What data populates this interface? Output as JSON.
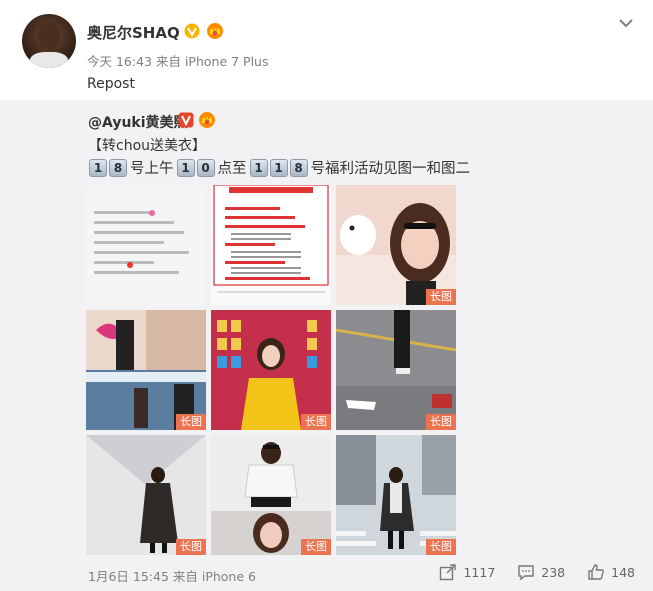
{
  "header": {
    "username": "奥尼尔SHAQ",
    "meta": "今天 16:43 来自 iPhone 7 Plus",
    "repost_text": "Repost"
  },
  "original": {
    "username": "@Ayuki黄美熙",
    "line1": "【转chou送美衣】",
    "line2": {
      "k1": "1",
      "k2": "8",
      "t1": "号上午",
      "k3": "1",
      "k4": "0",
      "t2": "点至",
      "k5": "1",
      "k6": "1",
      "k7": "8",
      "t3": "号福利活动见图一和图二"
    },
    "images": [
      {
        "name": "image-1",
        "badge": ""
      },
      {
        "name": "image-2",
        "badge": ""
      },
      {
        "name": "image-3",
        "badge": "长图"
      },
      {
        "name": "image-4",
        "badge": "长图"
      },
      {
        "name": "image-5",
        "badge": "长图"
      },
      {
        "name": "image-6",
        "badge": "长图"
      },
      {
        "name": "image-7",
        "badge": "长图"
      },
      {
        "name": "image-8",
        "badge": "长图"
      },
      {
        "name": "image-9",
        "badge": "长图"
      }
    ],
    "footer_meta": "1月6日 15:45 来自 iPhone 6",
    "actions": {
      "reposts": "1117",
      "comments": "238",
      "likes": "148"
    }
  },
  "colors": {
    "badge": "#eb7350",
    "repost_bg": "#f2f2f5",
    "vip": "#f7b500"
  }
}
